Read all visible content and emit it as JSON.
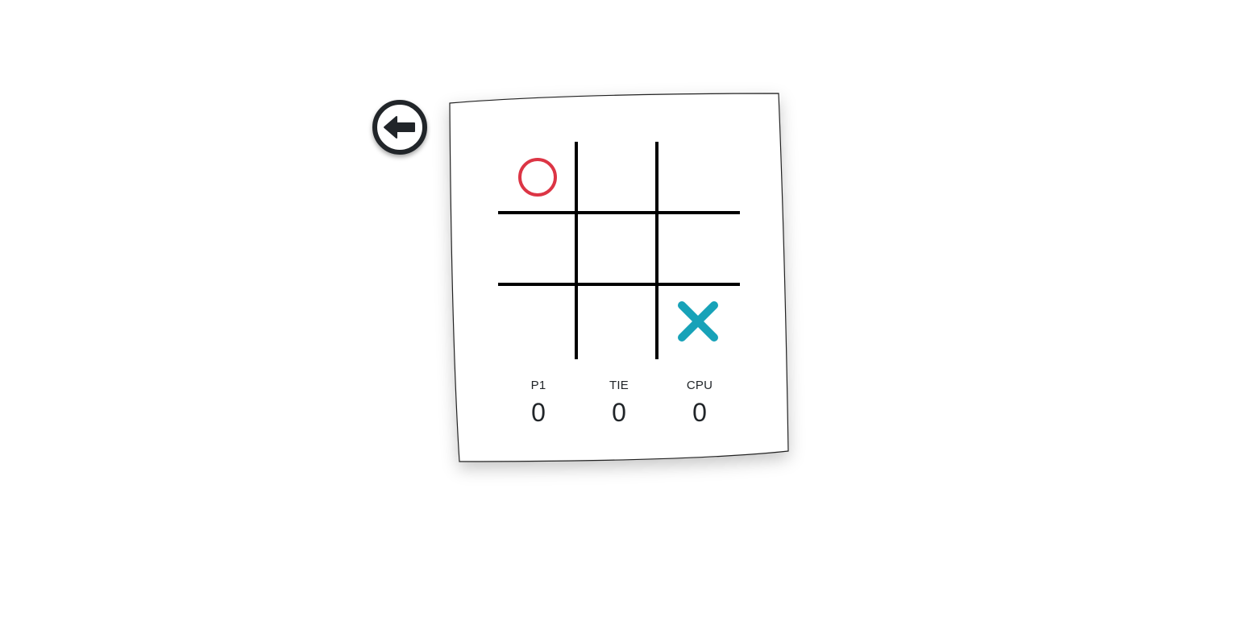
{
  "game": {
    "board": [
      "O",
      "",
      "",
      "",
      "",
      "",
      "",
      "",
      "X"
    ]
  },
  "scores": [
    {
      "label": "P1",
      "value": "0"
    },
    {
      "label": "TIE",
      "value": "0"
    },
    {
      "label": "CPU",
      "value": "0"
    }
  ],
  "colors": {
    "o_mark": "#dc3545",
    "x_mark": "#17a2b8",
    "grid": "#000000",
    "icon": "#212529",
    "text": "#212529"
  },
  "icons": {
    "back": "arrow-left-circle-icon",
    "o": "circle-mark-icon",
    "x": "cross-mark-icon"
  }
}
